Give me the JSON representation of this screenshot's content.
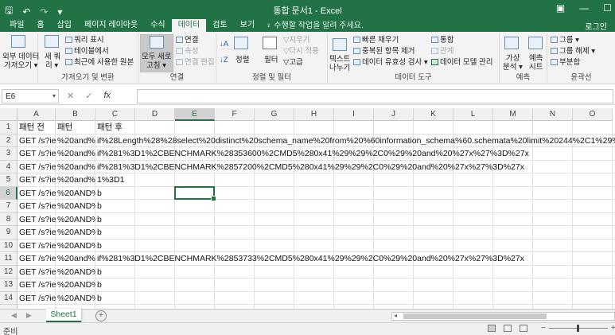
{
  "titlebar": {
    "title": "통합 문서1 - Excel",
    "save_icon": "save-icon",
    "undo_icon": "undo-icon",
    "redo_icon": "redo-icon",
    "qat_more": "▾"
  },
  "tabs": [
    {
      "label": "파일",
      "active": false
    },
    {
      "label": "홈",
      "active": false
    },
    {
      "label": "삽입",
      "active": false
    },
    {
      "label": "페이지 레이아웃",
      "active": false
    },
    {
      "label": "수식",
      "active": false
    },
    {
      "label": "데이터",
      "active": true
    },
    {
      "label": "검토",
      "active": false
    },
    {
      "label": "보기",
      "active": false
    }
  ],
  "tell_me": "♀ 수행할 작업을 알려 주세요.",
  "login": "로그인",
  "ribbon": {
    "ext_data": [
      "외부 데이터",
      "가져오기 ▾"
    ],
    "new_query": [
      "새 쿼",
      "리 ▾"
    ],
    "show_query": "쿼리 표시",
    "from_table": "테이블에서",
    "recent_sources": "최근에 사용한 원본",
    "group_get_transform": "가져오기 및 변환",
    "refresh_all": [
      "모두 새로",
      "고침 ▾"
    ],
    "connections": "연결",
    "properties": "속성",
    "edit_links": "연결 편집",
    "group_connections": "연결",
    "sort_asc": "↓A",
    "sort": "정렬",
    "filter": "필터",
    "clear": "지우기",
    "reapply": "다시 적용",
    "advanced": "고급",
    "group_sort_filter": "정렬 및 필터",
    "text_to_columns": [
      "텍스트",
      "나누기"
    ],
    "flash_fill": "빠른 채우기",
    "remove_dup": "중복된 항목 제거",
    "data_validation": "데이터 유효성 검사 ▾",
    "consolidate": "통합",
    "relationships": "관계",
    "data_model": "데이터 모델 관리",
    "group_data_tools": "데이터 도구",
    "whatif": [
      "가상",
      "분석 ▾"
    ],
    "forecast_sheet": [
      "예측",
      "시트"
    ],
    "group_forecast": "예측",
    "group": "그룹 ▾",
    "ungroup": "그룹 해제 ▾",
    "subtotal": "부분합",
    "group_outline": "윤곽선"
  },
  "formula_bar": {
    "name_box": "E6",
    "cancel": "✕",
    "enter": "✓",
    "fx": "fx",
    "value": ""
  },
  "columns": [
    "A",
    "B",
    "C",
    "D",
    "E",
    "F",
    "G",
    "H",
    "I",
    "J",
    "K",
    "L",
    "M",
    "N",
    "O"
  ],
  "selected_column": "E",
  "selected_row": "6",
  "rows": [
    {
      "n": "1",
      "a": "패턴 전",
      "b": "패턴",
      "c": "패턴 후"
    },
    {
      "n": "2",
      "a": "GET /s?ie=",
      "b": "%20and%",
      "c": "if%28Length%28%28select%20distinct%20schema_name%20from%20%60information_schema%60.schemata%20limit%20244%2C1%29%29%29"
    },
    {
      "n": "3",
      "a": "GET /s?ie=",
      "b": "%20and%",
      "c": "if%281%3D1%2CBENCHMARK%28353600%2CMD5%280x41%29%29%2C0%29%20and%20%27x%27%3D%27x"
    },
    {
      "n": "4",
      "a": "GET /s?ie=",
      "b": "%20and%",
      "c": "if%281%3D1%2CBENCHMARK%2857200%2CMD5%280x41%29%29%2C0%29%20and%20%27x%27%3D%27x"
    },
    {
      "n": "5",
      "a": "GET /s?ie=",
      "b": "%20and%",
      "c": "1%3D1"
    },
    {
      "n": "6",
      "a": "GET /s?ie=",
      "b": "%20AND%",
      "c": "b"
    },
    {
      "n": "7",
      "a": "GET /s?ie=",
      "b": "%20AND%",
      "c": "b"
    },
    {
      "n": "8",
      "a": "GET /s?ie=",
      "b": "%20AND%",
      "c": "b"
    },
    {
      "n": "9",
      "a": "GET /s?ie=",
      "b": "%20AND%",
      "c": "b"
    },
    {
      "n": "10",
      "a": "GET /s?ie=",
      "b": "%20AND%",
      "c": "b"
    },
    {
      "n": "11",
      "a": "GET /s?ie=",
      "b": "%20and%",
      "c": "if%281%3D1%2CBENCHMARK%2853733%2CMD5%280x41%29%29%2C0%29%20and%20%27x%27%3D%27x"
    },
    {
      "n": "12",
      "a": "GET /s?ie=",
      "b": "%20AND%",
      "c": "b"
    },
    {
      "n": "13",
      "a": "GET /s?ie=",
      "b": "%20AND%",
      "c": "b"
    },
    {
      "n": "14",
      "a": "GET /s?ie=",
      "b": "%20AND%",
      "c": "b"
    }
  ],
  "sheet": {
    "tab": "Sheet1",
    "add": "+",
    "nav_prev": "◀",
    "nav_next": "▶"
  },
  "status": {
    "ready": "준비",
    "zoom_minus": "−",
    "zoom_plus": "+"
  },
  "colors": {
    "excel_green": "#217346"
  }
}
